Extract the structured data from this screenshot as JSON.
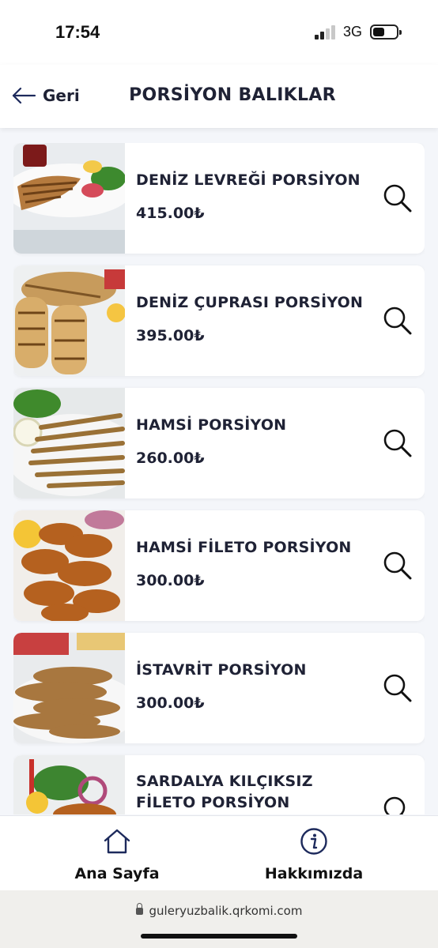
{
  "status_bar": {
    "time": "17:54",
    "network": "3G"
  },
  "header": {
    "back_label": "Geri",
    "title": "PORSİYON BALIKLAR"
  },
  "products": [
    {
      "name": "DENİZ LEVREĞİ PORSİYON",
      "price": "415.00₺",
      "image_icon": "grilled-sea-bass-photo"
    },
    {
      "name": "DENİZ ÇUPRASI PORSİYON",
      "price": "395.00₺",
      "image_icon": "grilled-sea-bream-photo"
    },
    {
      "name": "HAMSİ PORSİYON",
      "price": "260.00₺",
      "image_icon": "fried-anchovy-photo"
    },
    {
      "name": "HAMSİ FİLETO PORSİYON",
      "price": "300.00₺",
      "image_icon": "anchovy-fillet-photo"
    },
    {
      "name": "İSTAVRİT PORSİYON",
      "price": "300.00₺",
      "image_icon": "fried-horse-mackerel-photo"
    },
    {
      "name": "SARDALYA KILÇIKSIZ FİLETO PORSİYON",
      "price": "",
      "image_icon": "sardine-fillet-photo"
    }
  ],
  "bottom_nav": {
    "home_label": "Ana Sayfa",
    "about_label": "Hakkımızda"
  },
  "browser": {
    "url": "guleryuzbalik.qrkomi.com"
  },
  "colors": {
    "text": "#1f2235",
    "accent": "#1d2a5c",
    "background": "#f4f6fa"
  }
}
